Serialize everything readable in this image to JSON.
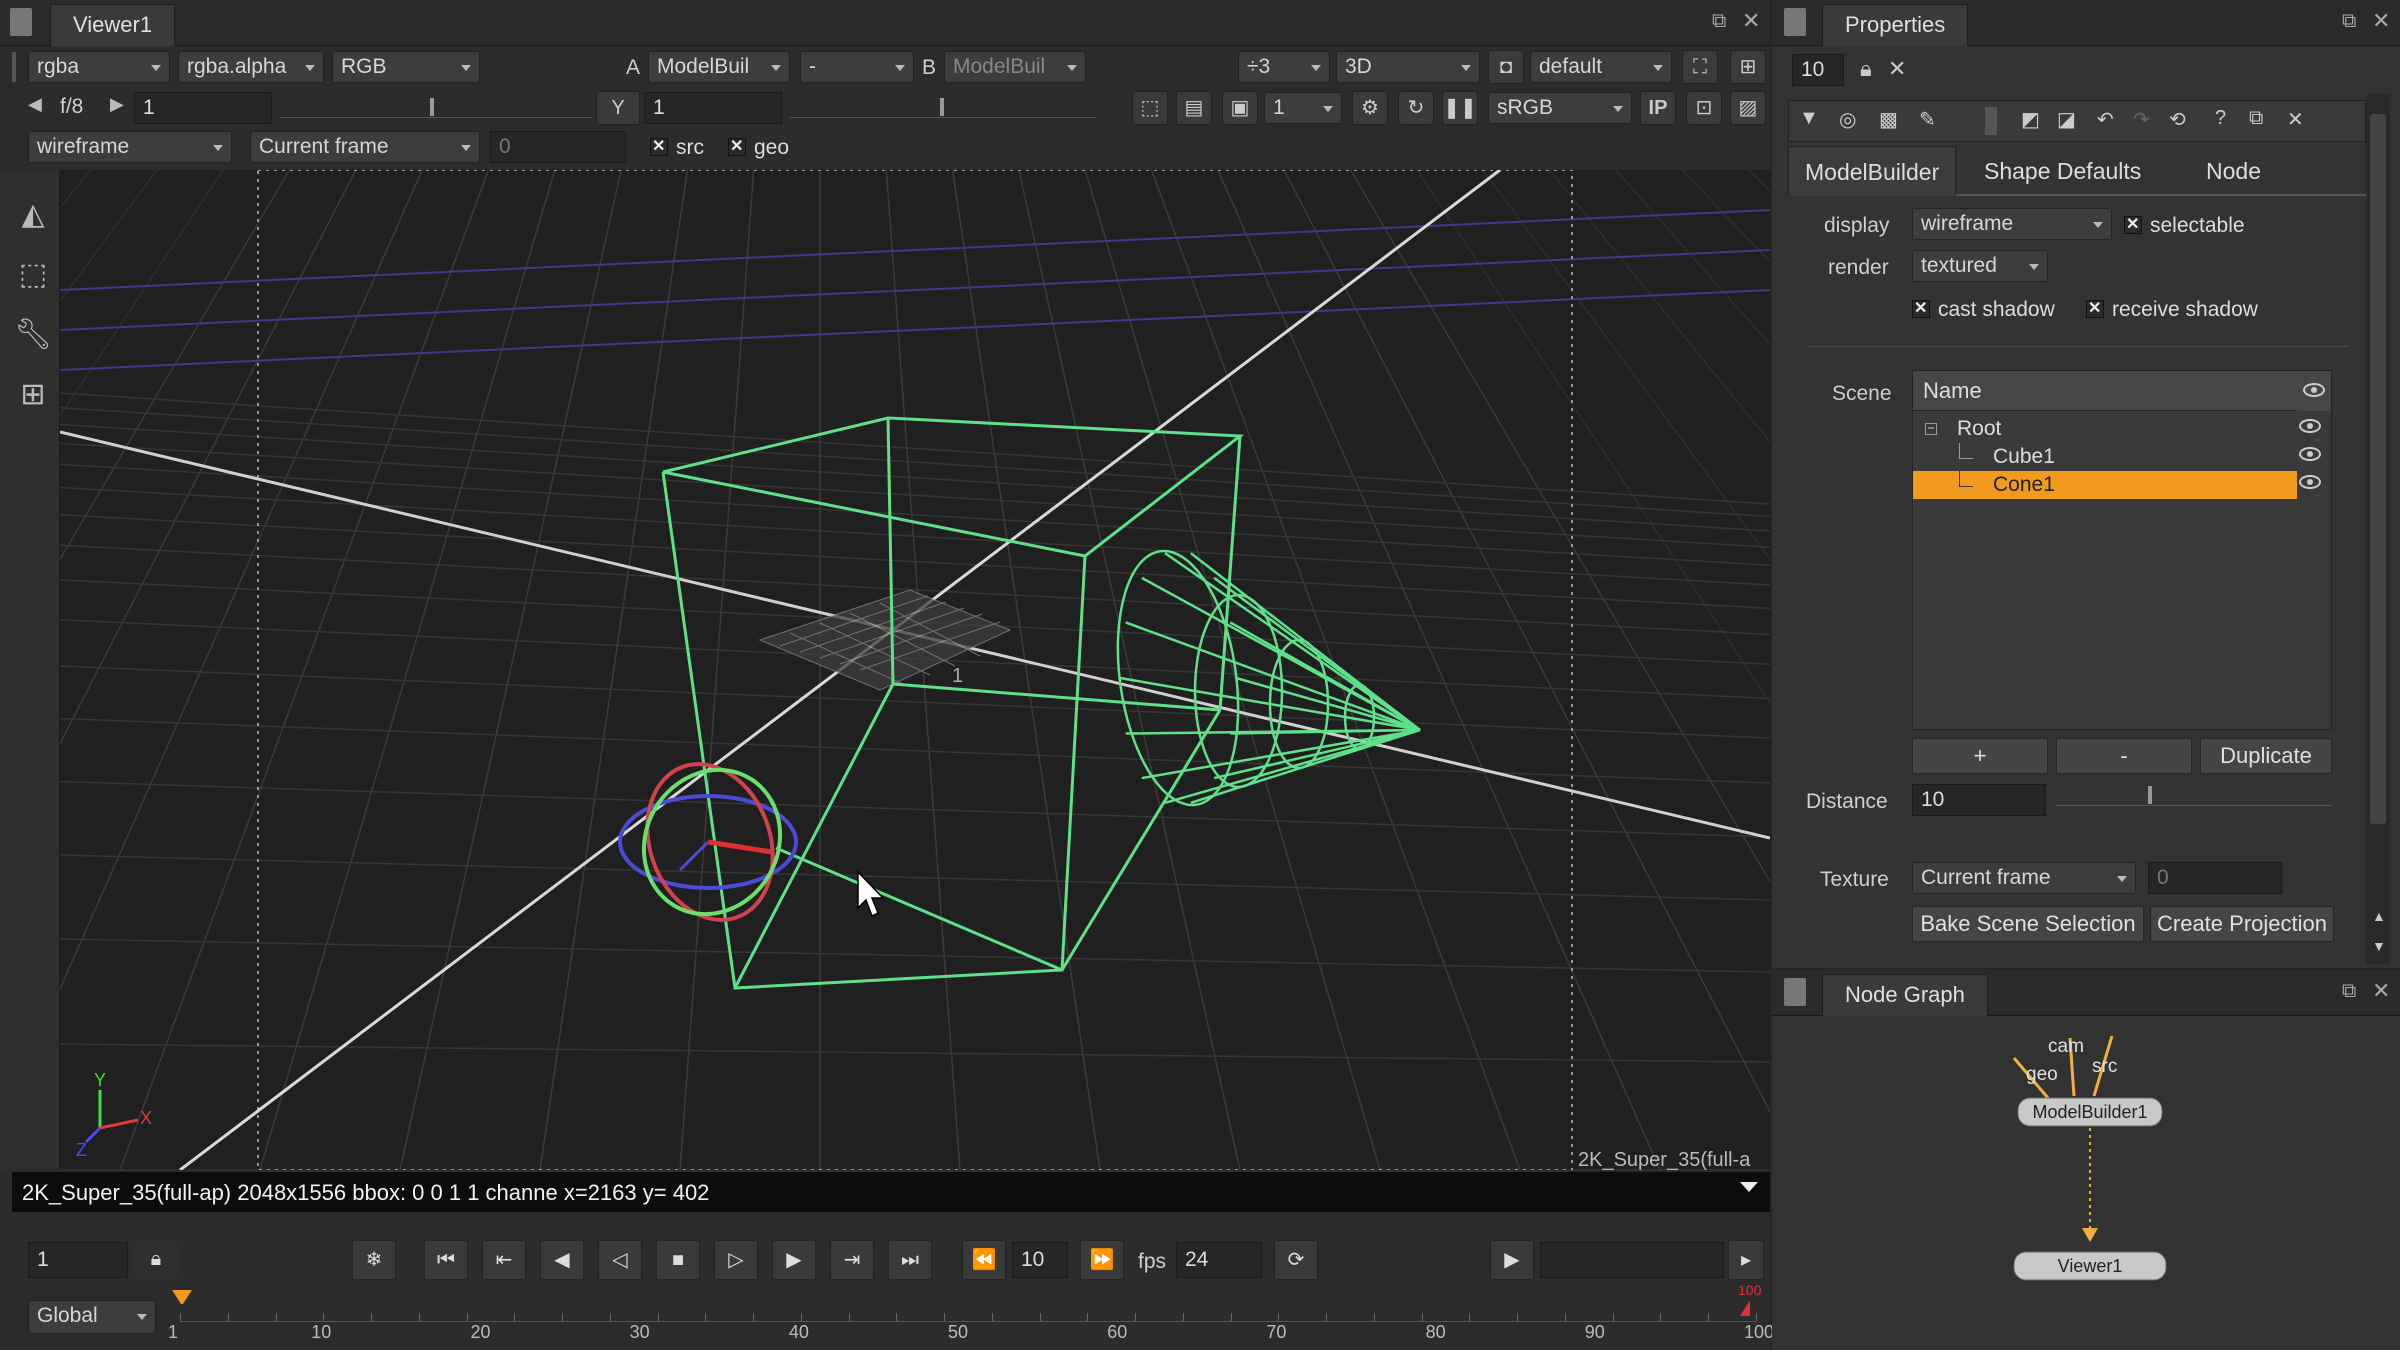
{
  "viewer": {
    "tab": "Viewer1",
    "channels": "rgba",
    "alpha": "rgba.alpha",
    "display_channel": "RGB",
    "input_a_label": "A",
    "input_a": "ModelBuil",
    "op": "-",
    "input_b_label": "B",
    "input_b": "ModelBuil",
    "zoom": "÷3",
    "view_mode": "3D",
    "camera": "default",
    "fstop": "f/8",
    "gain": "1",
    "gamma_label": "Y",
    "gamma": "1",
    "proxy": "1",
    "lut": "sRGB",
    "ip": "IP",
    "render_mode": "wireframe",
    "frame_mode": "Current frame",
    "frame_value": "0",
    "src": "src",
    "geo": "geo",
    "format_label": "2K_Super_35(full-a",
    "status": "2K_Super_35(full-ap) 2048x1556 bbox: 0 0 1 1 channe  x=2163 y= 402",
    "axis_y": "Y",
    "axis_x": "X",
    "axis_z": "Z",
    "card_label": "1"
  },
  "timeline": {
    "frame": "1",
    "current_frame": "10",
    "fps_label": "fps",
    "fps": "24",
    "scope": "Global",
    "end_marker": "100",
    "ticks": [
      "1",
      "10",
      "20",
      "30",
      "40",
      "50",
      "60",
      "70",
      "80",
      "90",
      "100"
    ]
  },
  "properties": {
    "tab": "Properties",
    "max_panels": "10",
    "tabs": [
      "ModelBuilder",
      "Shape Defaults",
      "Node"
    ],
    "display_label": "display",
    "display_value": "wireframe",
    "selectable": "selectable",
    "render_label": "render",
    "render_value": "textured",
    "cast_shadow": "cast shadow",
    "receive_shadow": "receive shadow",
    "scene_label": "Scene",
    "scene_header": "Name",
    "scene_items": [
      "Root",
      "Cube1",
      "Cone1"
    ],
    "selected_item": "Cone1",
    "add": "+",
    "remove": "-",
    "duplicate": "Duplicate",
    "distance_label": "Distance",
    "distance_value": "10",
    "distance_ticks": [
      "1",
      "10",
      "100",
      "1000"
    ],
    "texture_label": "Texture",
    "texture_value": "Current frame",
    "texture_frame": "0",
    "bake": "Bake Scene Selection",
    "create_projection": "Create Projection"
  },
  "node_graph": {
    "tab": "Node Graph",
    "inputs": [
      "cam",
      "geo",
      "src"
    ],
    "node_main": "ModelBuilder1",
    "node_viewer": "Viewer1"
  },
  "colors": {
    "wire": "#5fe08a",
    "selection": "#f29a1e",
    "grid": "#3a3a3a",
    "far_grid": "#3b3b8a"
  }
}
